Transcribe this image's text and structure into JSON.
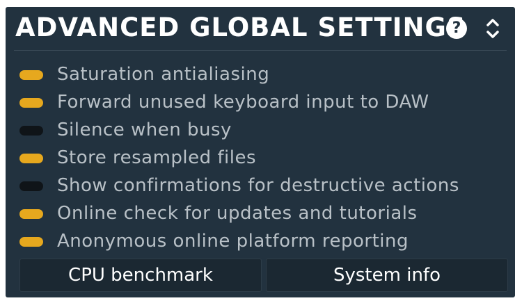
{
  "panel": {
    "title": "ADVANCED GLOBAL SETTINGS",
    "help_icon": "question-mark-icon",
    "help_glyph": "?",
    "expand_icon": "chevron-up-down-icon"
  },
  "settings": [
    {
      "label": "Saturation antialiasing",
      "enabled": true
    },
    {
      "label": "Forward unused keyboard input to DAW",
      "enabled": true
    },
    {
      "label": "Silence when busy",
      "enabled": false
    },
    {
      "label": "Store resampled files",
      "enabled": true
    },
    {
      "label": "Show confirmations for destructive actions",
      "enabled": false
    },
    {
      "label": "Online check for updates and tutorials",
      "enabled": true
    },
    {
      "label": "Anonymous online platform reporting",
      "enabled": true
    }
  ],
  "buttons": {
    "cpu_benchmark": "CPU benchmark",
    "system_info": "System info"
  },
  "colors": {
    "panel_bg": "#22323f",
    "toggle_on": "#e6a81e",
    "toggle_off": "#0f1418",
    "label_text": "#b9c1c7"
  }
}
